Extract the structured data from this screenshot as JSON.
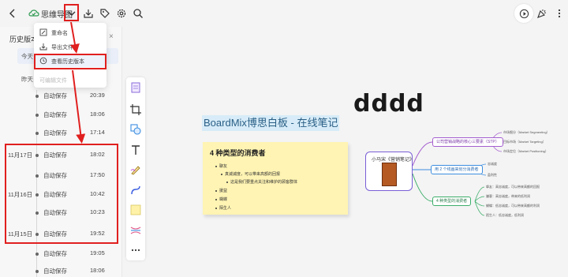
{
  "doc_title": "思维导图",
  "history": {
    "title": "历史版本",
    "close": "×",
    "today": "今天",
    "yesterday": "昨天",
    "rows": [
      {
        "date": "",
        "label": "自动保存",
        "time": "20:39"
      },
      {
        "date": "",
        "label": "自动保存",
        "time": "18:06"
      },
      {
        "date": "",
        "label": "自动保存",
        "time": "17:14"
      },
      {
        "date": "11月17日",
        "label": "自动保存",
        "time": "18:02"
      },
      {
        "date": "",
        "label": "自动保存",
        "time": "17:50"
      },
      {
        "date": "11月16日",
        "label": "自动保存",
        "time": "10:42"
      },
      {
        "date": "",
        "label": "自动保存",
        "time": "10:23"
      },
      {
        "date": "11月15日",
        "label": "自动保存",
        "time": "19:52"
      },
      {
        "date": "",
        "label": "自动保存",
        "time": "19:05"
      },
      {
        "date": "",
        "label": "自动保存",
        "time": "18:06"
      }
    ]
  },
  "menu": {
    "rename": "重命名",
    "export": "导出文件",
    "history": "查看历史版本",
    "editable": "可编辑文件"
  },
  "canvas": {
    "big_title": "dddd",
    "heading": "BoardMix博思白板 - 在线笔记",
    "sticky": {
      "title": "4 种类型的消费者",
      "lines": [
        "聊友",
        "真诚诚度，可以带来高额的回报",
        "这是我们要重点关注和维护的顾客群体",
        "援益",
        "蝴蝶",
        "陌生人"
      ]
    },
    "mindmap": {
      "root": "小马宋《营销笔记》",
      "branches": [
        "公司营销战略的核心三要素（STP）",
        "用 2 个线画来划分消费者",
        "4 种类型的消费者"
      ],
      "leaves": [
        "市场细分（Market Segmenting）",
        "目标市场（Market Targeting）",
        "市场定位（Market Positioning）",
        "忠诚度",
        "盈利性",
        "挚友：高忠诚度，可以带来高额的回报",
        "嫌客：高忠诚度，带来的低利润",
        "蝴蝶：低忠诚度，可以带来高额的利润",
        "陌生人：低忠诚度，低利润"
      ]
    }
  },
  "colors": {
    "annotation_red": "#e0201f",
    "accent_purple": "#7a5fd6",
    "branch_purple": "#a55ecf",
    "branch_blue": "#3c8de0",
    "branch_green": "#3dae6b"
  },
  "icons": [
    "back-icon",
    "cloud-sync-icon",
    "chevron-down-icon",
    "download-icon",
    "tag-icon",
    "settings-icon",
    "search-icon",
    "play-icon",
    "celebrate-icon",
    "more-icon"
  ]
}
